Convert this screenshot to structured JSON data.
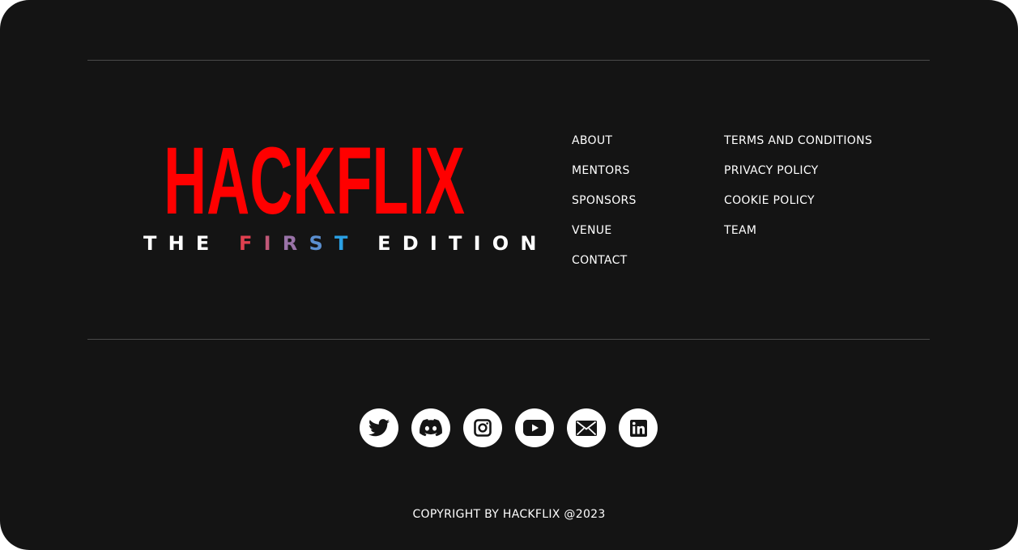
{
  "brand": {
    "logo_text": "HACKFLIX",
    "logo_color": "#ff0000",
    "edition_letters": [
      {
        "char": "T",
        "color": "#ffffff"
      },
      {
        "char": "H",
        "color": "#ffffff"
      },
      {
        "char": "E",
        "color": "#ffffff"
      },
      {
        "char": " ",
        "color": "#ffffff"
      },
      {
        "char": "F",
        "color": "#e0404f"
      },
      {
        "char": "I",
        "color": "#c05878"
      },
      {
        "char": "R",
        "color": "#9a73a8"
      },
      {
        "char": "S",
        "color": "#5b8fd0"
      },
      {
        "char": "T",
        "color": "#2aa0e4"
      },
      {
        "char": " ",
        "color": "#ffffff"
      },
      {
        "char": "E",
        "color": "#ffffff"
      },
      {
        "char": "D",
        "color": "#ffffff"
      },
      {
        "char": "I",
        "color": "#ffffff"
      },
      {
        "char": "T",
        "color": "#ffffff"
      },
      {
        "char": "I",
        "color": "#ffffff"
      },
      {
        "char": "O",
        "color": "#ffffff"
      },
      {
        "char": "N",
        "color": "#ffffff"
      }
    ]
  },
  "links": {
    "col1": [
      "ABOUT",
      "MENTORS",
      "SPONSORS",
      "VENUE",
      "CONTACT"
    ],
    "col2": [
      "TERMS AND CONDITIONS",
      "PRIVACY POLICY",
      "COOKIE POLICY",
      "TEAM"
    ]
  },
  "socials": [
    {
      "name": "twitter-icon"
    },
    {
      "name": "discord-icon"
    },
    {
      "name": "instagram-icon"
    },
    {
      "name": "youtube-icon"
    },
    {
      "name": "email-icon"
    },
    {
      "name": "linkedin-icon"
    }
  ],
  "copyright": "COPYRIGHT BY HACKFLIX @2023",
  "colors": {
    "background": "#141414",
    "divider": "#4a4a4a",
    "accent": "#ff0000"
  }
}
